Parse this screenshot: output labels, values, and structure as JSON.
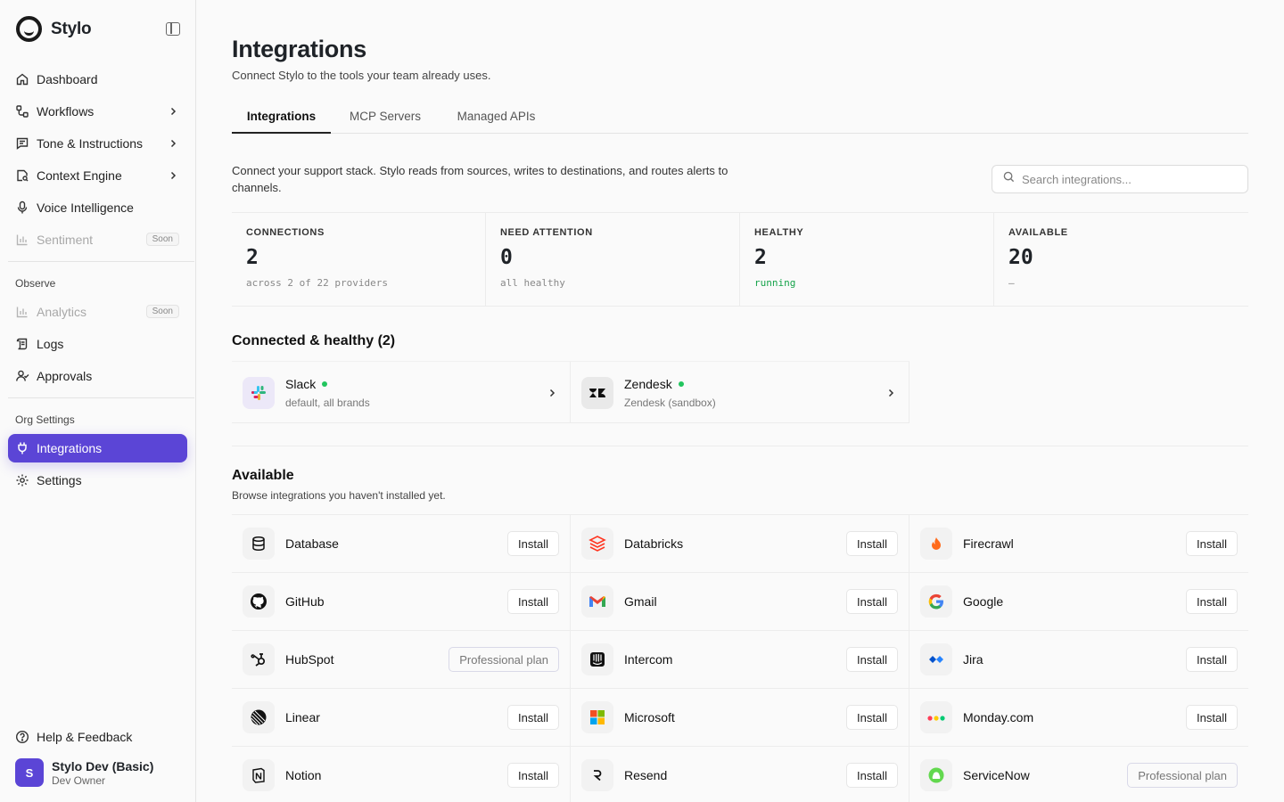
{
  "app": {
    "name": "Stylo"
  },
  "sidebar": {
    "items": [
      {
        "label": "Dashboard"
      },
      {
        "label": "Workflows"
      },
      {
        "label": "Tone & Instructions"
      },
      {
        "label": "Context Engine"
      },
      {
        "label": "Voice Intelligence"
      },
      {
        "label": "Sentiment",
        "badge": "Soon"
      }
    ],
    "observe_label": "Observe",
    "observe_items": [
      {
        "label": "Analytics",
        "badge": "Soon"
      },
      {
        "label": "Logs"
      },
      {
        "label": "Approvals"
      }
    ],
    "org_label": "Org Settings",
    "org_items": [
      {
        "label": "Integrations"
      },
      {
        "label": "Settings"
      }
    ],
    "help": "Help & Feedback",
    "user": {
      "initial": "S",
      "name": "Stylo Dev (Basic)",
      "role": "Dev Owner"
    }
  },
  "page": {
    "title": "Integrations",
    "subtitle": "Connect Stylo to the tools your team already uses.",
    "tabs": [
      "Integrations",
      "MCP Servers",
      "Managed APIs"
    ],
    "intro": "Connect your support stack. Stylo reads from sources, writes to destinations, and routes alerts to channels.",
    "search_placeholder": "Search integrations..."
  },
  "stats": [
    {
      "label": "CONNECTIONS",
      "value": "2",
      "note": "across 2 of 22 providers"
    },
    {
      "label": "NEED ATTENTION",
      "value": "0",
      "note": "all healthy"
    },
    {
      "label": "HEALTHY",
      "value": "2",
      "note": "running"
    },
    {
      "label": "AVAILABLE",
      "value": "20",
      "note": "—"
    }
  ],
  "connected": {
    "heading": "Connected & healthy (2)",
    "items": [
      {
        "name": "Slack",
        "desc": "default, all brands"
      },
      {
        "name": "Zendesk",
        "desc": "Zendesk (sandbox)"
      }
    ]
  },
  "available": {
    "heading": "Available",
    "subheading": "Browse integrations you haven't installed yet.",
    "install_label": "Install",
    "pro_label": "Professional plan",
    "items": [
      {
        "name": "Database",
        "icon": "database-icon"
      },
      {
        "name": "Databricks",
        "icon": "databricks-icon"
      },
      {
        "name": "Firecrawl",
        "icon": "firecrawl-icon"
      },
      {
        "name": "GitHub",
        "icon": "github-icon"
      },
      {
        "name": "Gmail",
        "icon": "gmail-icon"
      },
      {
        "name": "Google",
        "icon": "google-icon"
      },
      {
        "name": "HubSpot",
        "icon": "hubspot-icon",
        "plan": "pro"
      },
      {
        "name": "Intercom",
        "icon": "intercom-icon"
      },
      {
        "name": "Jira",
        "icon": "jira-icon"
      },
      {
        "name": "Linear",
        "icon": "linear-icon"
      },
      {
        "name": "Microsoft",
        "icon": "microsoft-icon"
      },
      {
        "name": "Monday.com",
        "icon": "monday-icon"
      },
      {
        "name": "Notion",
        "icon": "notion-icon"
      },
      {
        "name": "Resend",
        "icon": "resend-icon"
      },
      {
        "name": "ServiceNow",
        "icon": "servicenow-icon",
        "plan": "pro"
      }
    ]
  },
  "colors": {
    "accent": "#5b45d6",
    "healthy": "#22c55e"
  }
}
